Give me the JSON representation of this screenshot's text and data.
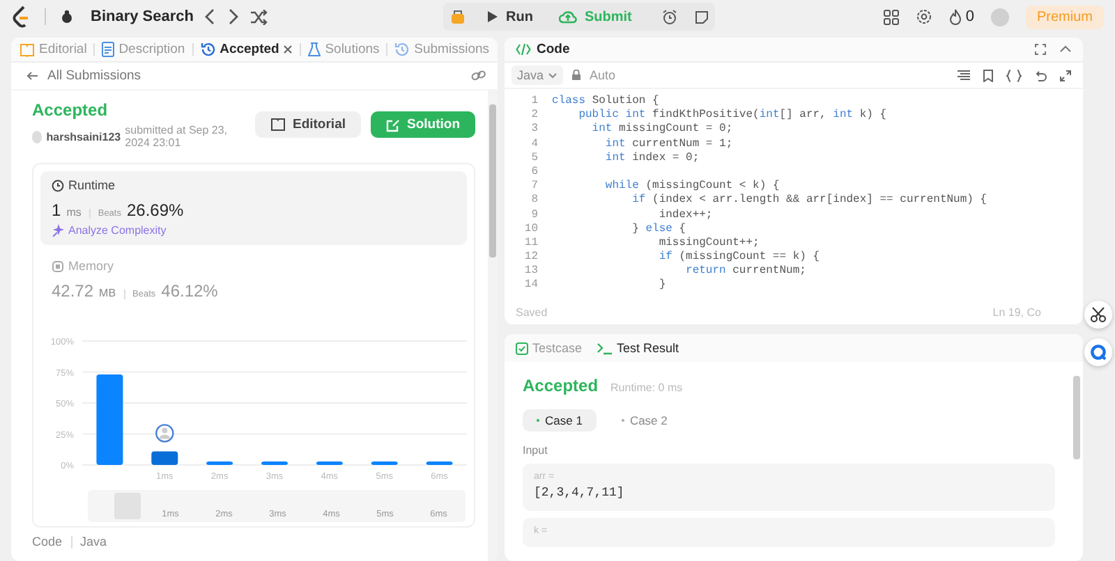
{
  "topbar": {
    "problem_title": "Binary Search",
    "buttons": [
      {
        "kind": "run",
        "label": "Run"
      },
      {
        "kind": "submit",
        "label": "Submit"
      }
    ],
    "streak_count": "0",
    "premium": "Premium"
  },
  "left_tabs": [
    {
      "kind": "editorial",
      "label": "Editorial",
      "selected": false
    },
    {
      "kind": "description",
      "label": "Description",
      "selected": false
    },
    {
      "kind": "accepted",
      "label": "Accepted",
      "selected": true
    },
    {
      "kind": "solutions",
      "label": "Solutions",
      "selected": false
    },
    {
      "kind": "submissions",
      "label": "Submissions",
      "selected": false
    }
  ],
  "back_link": "All Submissions",
  "submission": {
    "status": "Accepted",
    "user": "harshsaini123",
    "submitted": "submitted at Sep 23, 2024 23:01",
    "editorial_button": "Editorial",
    "solution_button": "Solution"
  },
  "runtime": {
    "title": "Runtime",
    "value": "1",
    "unit": "ms",
    "beats_label": "Beats",
    "beats": "26.69%",
    "analyze": "Analyze Complexity"
  },
  "memory": {
    "title": "Memory",
    "value": "42.72",
    "unit": "MB",
    "beats_label": "Beats",
    "beats": "46.12%"
  },
  "chart_data": {
    "type": "bar",
    "grid": true,
    "categories": [
      null,
      "1ms",
      "2ms",
      "3ms",
      "4ms",
      "5ms",
      "6ms"
    ],
    "values": [
      73,
      11,
      2,
      2,
      2,
      2,
      2
    ],
    "ylim": [
      0,
      100
    ],
    "yticks": [
      {
        "value": 0,
        "label": "0%"
      },
      {
        "value": 25,
        "label": "25%"
      },
      {
        "value": 50,
        "label": "50%"
      },
      {
        "value": 75,
        "label": "75%"
      },
      {
        "value": 100,
        "label": "100%"
      }
    ]
  },
  "overview_labels": [
    "1ms",
    "2ms",
    "3ms",
    "4ms",
    "5ms",
    "6ms"
  ],
  "footer_tabs": [
    "Code",
    "Java"
  ],
  "code_panel": {
    "title": "Code",
    "language": "Java",
    "mode": "Auto",
    "lines": [
      {
        "number": "1",
        "tokens": [
          {
            "kind": "kw",
            "text": "class"
          },
          {
            "kind": "id",
            "text": " Solution {"
          }
        ]
      },
      {
        "number": "2",
        "tokens": [
          {
            "kind": "kw",
            "text": "    public int"
          },
          {
            "kind": "id",
            "text": " findKthPositive("
          },
          {
            "kind": "kw",
            "text": "int"
          },
          {
            "kind": "id",
            "text": "[] arr, "
          },
          {
            "kind": "kw",
            "text": "int"
          },
          {
            "kind": "id",
            "text": " k) {"
          }
        ]
      },
      {
        "number": "3",
        "tokens": [
          {
            "kind": "kw",
            "text": "      int"
          },
          {
            "kind": "id",
            "text": " missingCount = 0;"
          }
        ]
      },
      {
        "number": "4",
        "tokens": [
          {
            "kind": "kw",
            "text": "        int"
          },
          {
            "kind": "id",
            "text": " currentNum = 1;"
          }
        ]
      },
      {
        "number": "5",
        "tokens": [
          {
            "kind": "kw",
            "text": "        int"
          },
          {
            "kind": "id",
            "text": " index = 0;"
          }
        ]
      },
      {
        "number": "6"
      },
      {
        "number": "7",
        "tokens": [
          {
            "kind": "kw",
            "text": "        while"
          },
          {
            "kind": "id",
            "text": " (missingCount < k) {"
          }
        ]
      },
      {
        "number": "8",
        "tokens": [
          {
            "kind": "kw",
            "text": "            if"
          },
          {
            "kind": "id",
            "text": " (index < arr.length && arr[index] == currentNum) {"
          }
        ]
      },
      {
        "number": "9",
        "tokens": [
          {
            "kind": "id",
            "text": "                index++;"
          }
        ]
      },
      {
        "number": "10",
        "tokens": [
          {
            "kind": "id",
            "text": "            } "
          },
          {
            "kind": "kw",
            "text": "else"
          },
          {
            "kind": "id",
            "text": " {"
          }
        ]
      },
      {
        "number": "11",
        "tokens": [
          {
            "kind": "id",
            "text": "                missingCount++;"
          }
        ]
      },
      {
        "number": "12",
        "tokens": [
          {
            "kind": "kw",
            "text": "                if"
          },
          {
            "kind": "id",
            "text": " (missingCount == k) {"
          }
        ]
      },
      {
        "number": "13",
        "tokens": [
          {
            "kind": "kw",
            "text": "                    return"
          },
          {
            "kind": "id",
            "text": " currentNum;"
          }
        ]
      },
      {
        "number": "14",
        "tokens": [
          {
            "kind": "id",
            "text": "                }"
          }
        ]
      }
    ],
    "status": "Saved",
    "cursor": "Ln 19, Co"
  },
  "result_panel": {
    "tabs": [
      {
        "kind": "testcase",
        "label": "Testcase",
        "selected": false
      },
      {
        "kind": "result",
        "label": "Test Result",
        "selected": true
      }
    ],
    "status": "Accepted",
    "runtime": "Runtime: 0 ms",
    "cases": [
      {
        "label": "Case 1",
        "selected": true
      },
      {
        "label": "Case 2",
        "selected": false
      }
    ],
    "input_label": "Input",
    "inputs": [
      {
        "name": "arr =",
        "value": "[2,3,4,7,11]"
      },
      {
        "name": "k ="
      }
    ]
  }
}
